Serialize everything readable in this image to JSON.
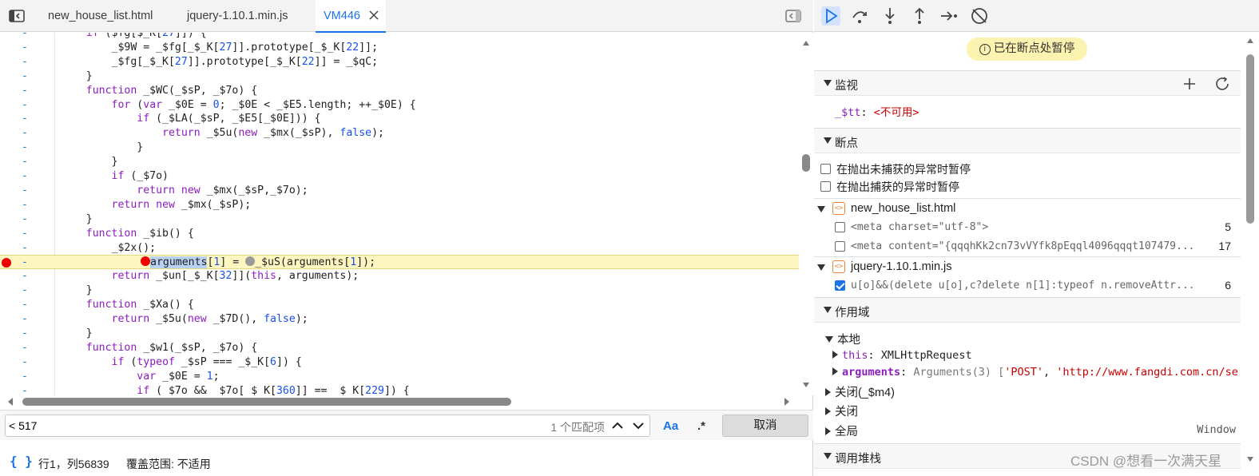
{
  "tabs": [
    {
      "label": "new_house_list.html"
    },
    {
      "label": "jquery-1.10.1.min.js"
    },
    {
      "label": "VM446"
    }
  ],
  "code_lines": [
    {
      "gutter": "-",
      "text": "    if ($fg[$_K[27]]) {"
    },
    {
      "gutter": "-",
      "text": "        _$9W = _$fg[_$_K[27]].prototype[_$_K[22]];"
    },
    {
      "gutter": "-",
      "text": "        _$fg[_$_K[27]].prototype[_$_K[22]] = _$qC;"
    },
    {
      "gutter": "-",
      "text": "    }"
    },
    {
      "gutter": "-",
      "text": "    function _$WC(_$sP, _$7o) {"
    },
    {
      "gutter": "-",
      "text": "        for (var _$0E = 0; _$0E < _$E5.length; ++_$0E) {"
    },
    {
      "gutter": "-",
      "text": "            if (_$LA(_$sP, _$E5[_$0E])) {"
    },
    {
      "gutter": "-",
      "text": "                return _$5u(new _$mx(_$sP), false);"
    },
    {
      "gutter": "-",
      "text": "            }"
    },
    {
      "gutter": "-",
      "text": "        }"
    },
    {
      "gutter": "-",
      "text": "        if (_$7o)"
    },
    {
      "gutter": "-",
      "text": "            return new _$mx(_$sP,_$7o);"
    },
    {
      "gutter": "-",
      "text": "        return new _$mx(_$sP);"
    },
    {
      "gutter": "-",
      "text": "    }"
    },
    {
      "gutter": "-",
      "text": "    function _$ib() {"
    },
    {
      "gutter": "-",
      "text": "        _$2x();"
    },
    {
      "gutter": "-",
      "text": "arguments[1] = _$uS(arguments[1]);"
    },
    {
      "gutter": "-",
      "text": "        return _$un[_$_K[32]](this, arguments);"
    },
    {
      "gutter": "-",
      "text": "    }"
    },
    {
      "gutter": "-",
      "text": "    function _$Xa() {"
    },
    {
      "gutter": "-",
      "text": "        return _$5u(new _$7D(), false);"
    },
    {
      "gutter": "-",
      "text": "    }"
    },
    {
      "gutter": "-",
      "text": "    function _$w1(_$sP, _$7o) {"
    },
    {
      "gutter": "-",
      "text": "        if (typeof _$sP === _$_K[6]) {"
    },
    {
      "gutter": "-",
      "text": "            var _$0E = 1;"
    },
    {
      "gutter": "-",
      "text": "            if (_$7o && _$7o[_$_K[360]] == _$_K[229]) {"
    }
  ],
  "search": {
    "value": "< 517",
    "match_count": "1 个匹配项",
    "case_label": "Aa",
    "regex_label": ".*",
    "cancel_label": "取消"
  },
  "status": {
    "pretty_icon": "{ }",
    "cursor_pos": "行1，列56839",
    "coverage": "覆盖范围: 不适用"
  },
  "debugger": {
    "paused_banner": "已在断点处暂停",
    "watch": {
      "title": "监视",
      "expr_name": "_$tt",
      "expr_value": "<不可用>"
    },
    "breakpoints": {
      "title": "断点",
      "opt_uncaught": "在抛出未捕获的异常时暂停",
      "opt_caught": "在抛出捕获的异常时暂停",
      "files": [
        {
          "name": "new_house_list.html",
          "items": [
            {
              "code": "<meta charset=\"utf-8\">",
              "line": "5",
              "checked": false
            },
            {
              "code": "<meta content=\"{qqqhKk2cn73vVYfk8pEqql4096qqqt107479...",
              "line": "17",
              "checked": false
            }
          ]
        },
        {
          "name": "jquery-1.10.1.min.js",
          "items": [
            {
              "code": "u[o]&&(delete u[o],c?delete n[1]:typeof n.removeAttr...",
              "line": "6",
              "checked": true
            }
          ]
        }
      ]
    },
    "scope": {
      "title": "作用域",
      "local": "本地",
      "this_key": "this",
      "this_val": "XMLHttpRequest",
      "args_key": "arguments",
      "args_val": "Arguments(3) [",
      "args_s1": "'POST'",
      "args_s2": "'http://www.fangdi.com.cn/se",
      "closure": "关闭(_$m4)",
      "closure2": "关闭",
      "global": "全局",
      "global_val": "Window"
    },
    "callstack": {
      "title": "调用堆栈"
    }
  },
  "watermark": "CSDN @想看一次满天星"
}
